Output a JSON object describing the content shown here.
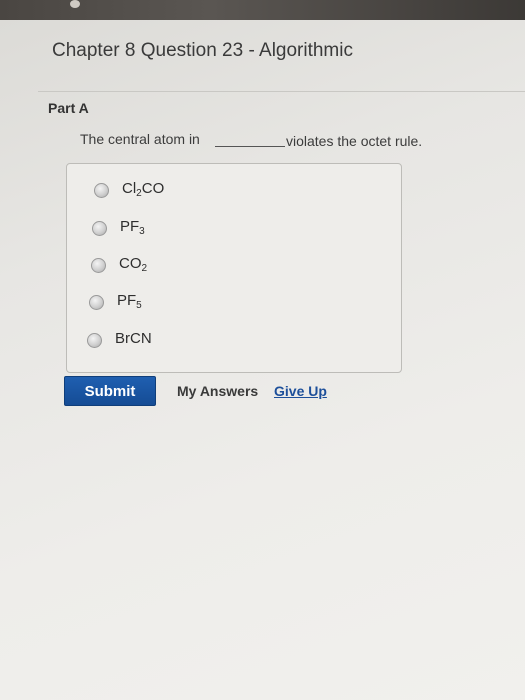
{
  "header": {
    "title": "Chapter 8 Question 23 - Algorithmic"
  },
  "part": {
    "label": "Part A"
  },
  "question": {
    "text_before": "The central atom in",
    "text_after": "violates the octet rule."
  },
  "options": [
    {
      "pre": "Cl",
      "sub": "2",
      "post": "CO"
    },
    {
      "pre": "PF",
      "sub": "3",
      "post": ""
    },
    {
      "pre": "CO",
      "sub": "2",
      "post": ""
    },
    {
      "pre": "PF",
      "sub": "5",
      "post": ""
    },
    {
      "pre": "BrCN",
      "sub": "",
      "post": ""
    }
  ],
  "actions": {
    "submit_label": "Submit",
    "my_answers_label": "My Answers",
    "give_up_label": "Give Up"
  },
  "colors": {
    "submit_bg": "#1a56a3",
    "link": "#1d4f9a"
  }
}
